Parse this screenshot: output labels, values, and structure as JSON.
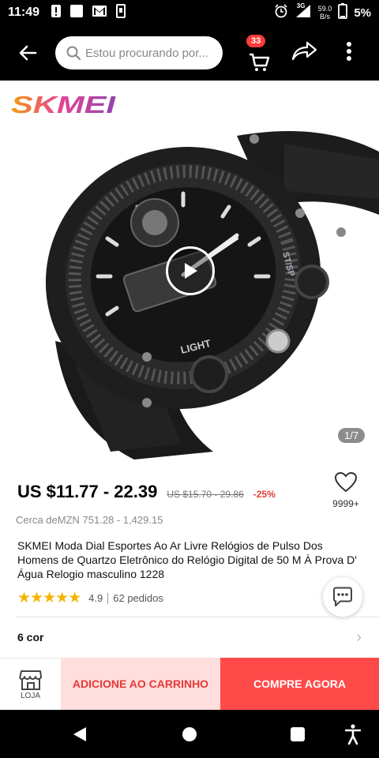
{
  "status_bar": {
    "time": "11:49",
    "network_speed_value": "59.0",
    "network_speed_unit": "B/s",
    "battery": "5%",
    "signal_label": "3G"
  },
  "header": {
    "search_placeholder": "Estou procurando por...",
    "cart_count": "33",
    "icons": [
      "back-arrow-icon",
      "search-icon",
      "cart-icon",
      "share-icon",
      "more-vertical-icon"
    ]
  },
  "product_image": {
    "brand": "SKMEI",
    "page_indicator": "1/7",
    "watch_label_light": "LIGHT",
    "watch_label_ststp": "ST/SP"
  },
  "price": {
    "range": "US $11.77 - 22.39",
    "original": "US $15.70 - 29.86",
    "discount": "-25%",
    "approx": "Cerca deMZN 751.28 - 1,429.15"
  },
  "wishlist": {
    "count": "9999+"
  },
  "product": {
    "title": "SKMEI Moda Dial Esportes Ao Ar Livre Relógios de Pulso Dos Homens de Quartzo Eletrônico do Relógio Digital de 50 M À Prova D' Água Relogio masculino 1228",
    "stars": "★★★★★",
    "rating": "4.9",
    "orders": "62 pedidos"
  },
  "variants": {
    "label": "6 cor"
  },
  "actions": {
    "store_label": "LOJA",
    "add_to_cart": "ADICIONE AO CARRINHO",
    "buy_now": "COMPRE AGORA"
  },
  "colors": {
    "accent_red": "#ff4a4a",
    "add_cart_bg": "#ffdede",
    "star": "#f5b400"
  }
}
